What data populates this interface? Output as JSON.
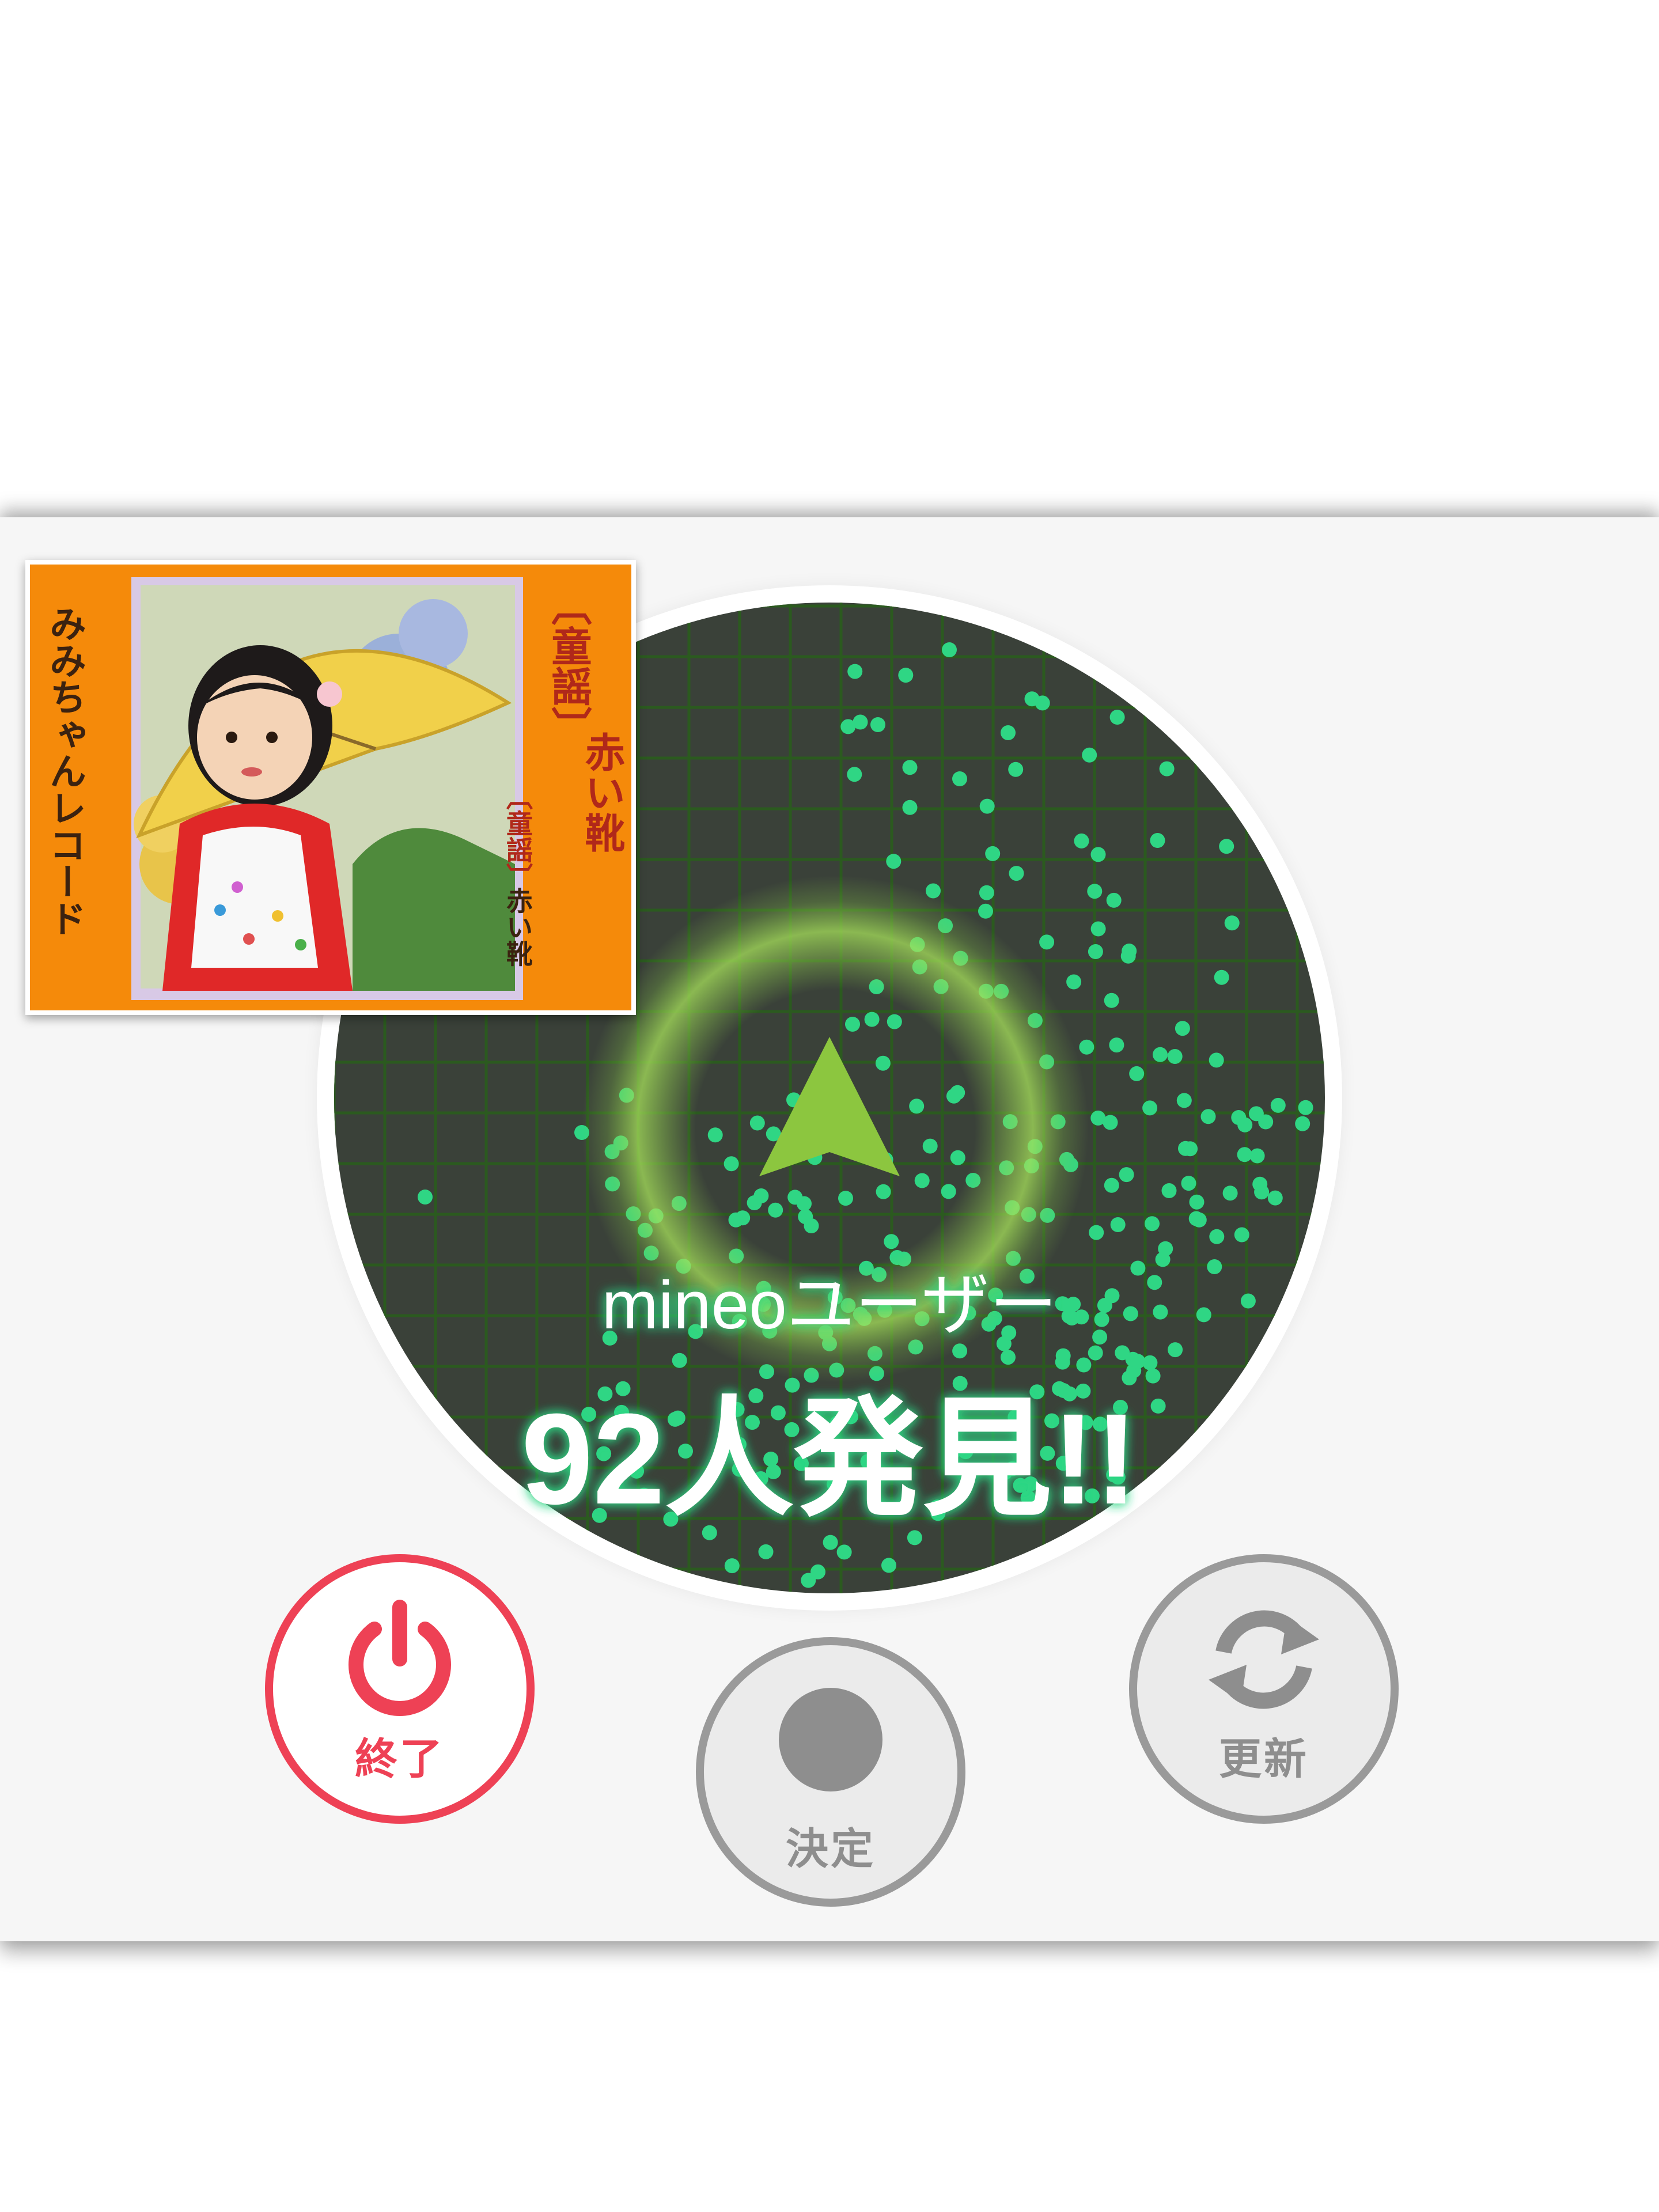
{
  "radar": {
    "user_label": "mineoユーザー",
    "count_text": "92人発見!!"
  },
  "thumbnail": {
    "genre": "〔童謡〕",
    "song_title": "赤い靴",
    "genre_small": "〔童謡〕",
    "song_title_small": "赤い靴",
    "label": "みみちゃんレコード"
  },
  "buttons": {
    "end_label": "終了",
    "decide_label": "決定",
    "refresh_label": "更新"
  },
  "colors": {
    "radar_bg": "#3a4139",
    "grid": "#2b5a1f",
    "dot": "#2fd684",
    "arrow": "#8cc63f",
    "end_red": "#ee4155",
    "gray": "#9a9a9a",
    "thumb_orange": "#f58a0a"
  },
  "icons": {
    "end": "power-icon",
    "decide": "record-dot-icon",
    "refresh": "refresh-icon",
    "direction": "direction-arrow-icon"
  }
}
